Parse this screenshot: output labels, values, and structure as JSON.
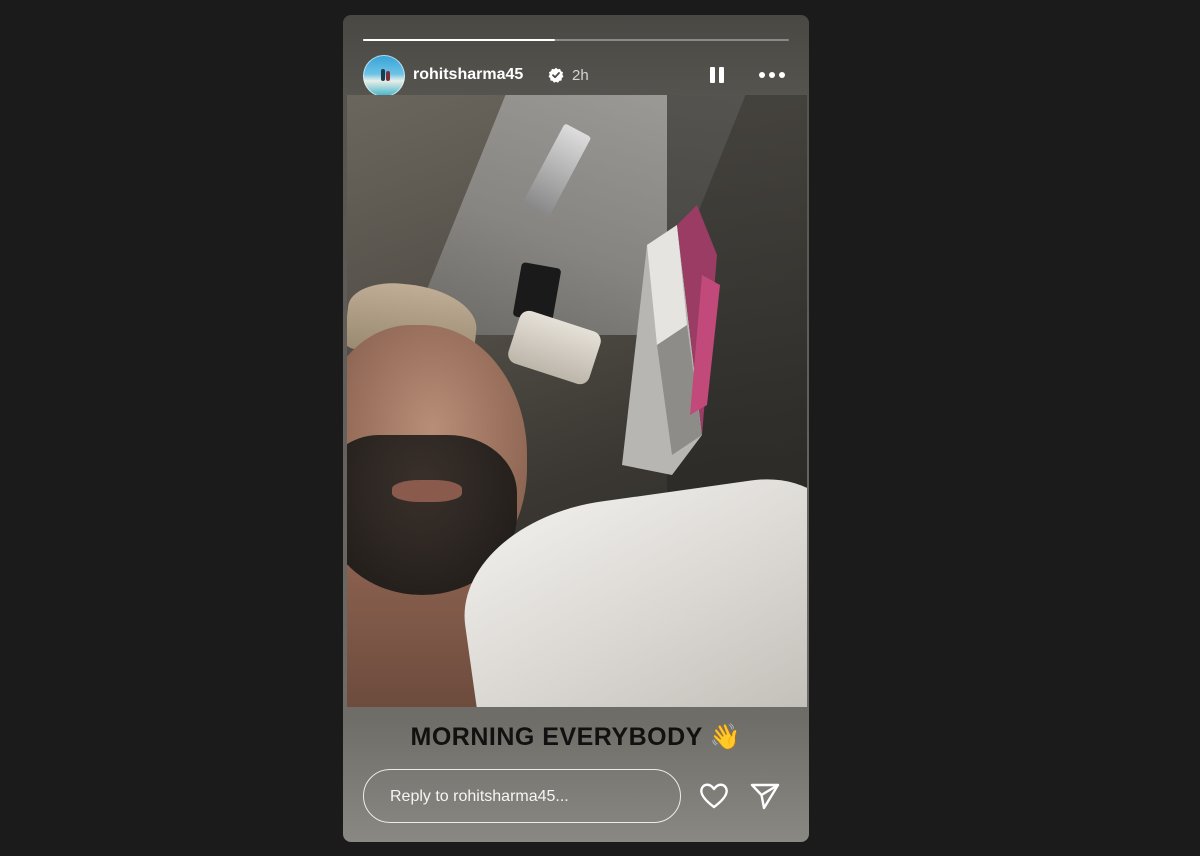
{
  "story": {
    "progress": 0.45,
    "username": "rohitsharma45",
    "verified": true,
    "timestamp": "2h",
    "caption": "MORNING EVERYBODY 👋",
    "reply_placeholder": "Reply to rohitsharma45..."
  },
  "colors": {
    "background": "#1b1b1b",
    "verified_badge": "#ffffff",
    "caption_text": "#111111"
  },
  "icons": {
    "pause": "pause-icon",
    "more": "more-icon",
    "like": "heart-icon",
    "share": "send-icon",
    "verified": "verified-badge-icon"
  }
}
